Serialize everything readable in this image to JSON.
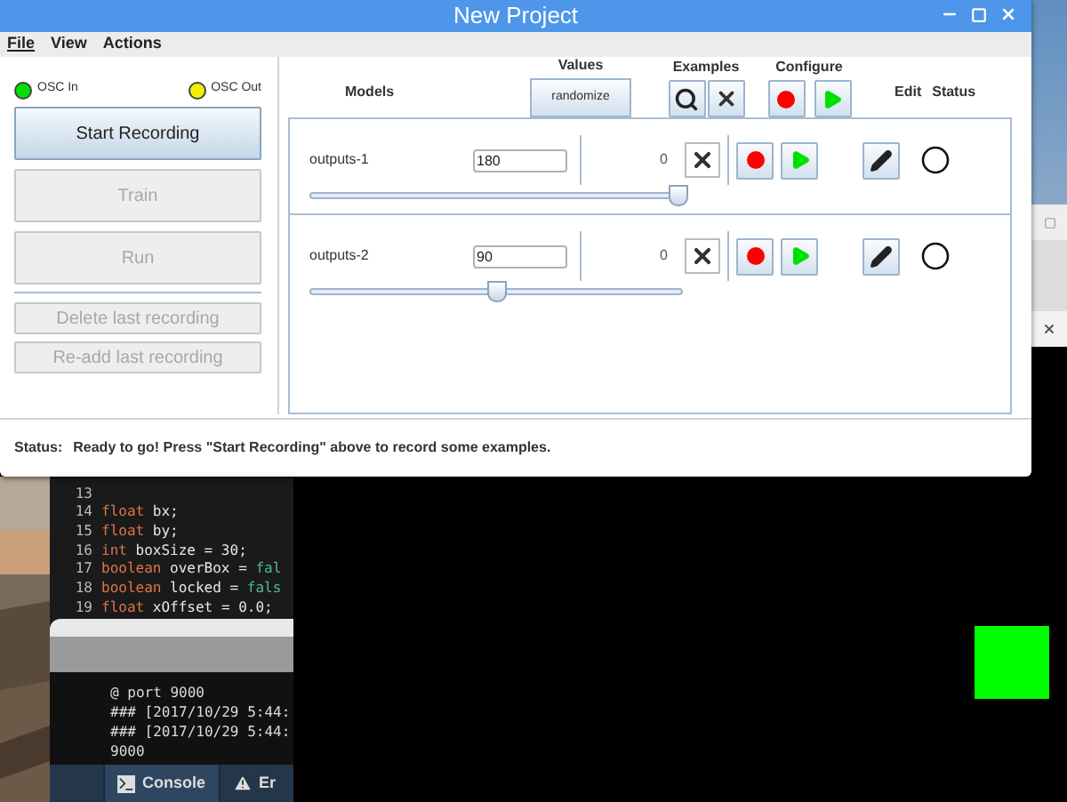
{
  "window": {
    "title": "New Project"
  },
  "menu": [
    {
      "label": "File",
      "underlined": true
    },
    {
      "label": "View",
      "underlined": false
    },
    {
      "label": "Actions",
      "underlined": false
    }
  ],
  "osc": [
    {
      "label": "OSC In",
      "color": "#00e000"
    },
    {
      "label": "OSC Out",
      "color": "#f0f000"
    }
  ],
  "main_buttons": [
    {
      "label": "Start Recording",
      "disabled": false
    },
    {
      "label": "Train",
      "disabled": true
    },
    {
      "label": "Run",
      "disabled": true
    }
  ],
  "secondary_buttons": [
    {
      "label": "Delete last recording",
      "disabled": true
    },
    {
      "label": "Re-add last recording",
      "disabled": true
    }
  ],
  "headers": {
    "models": "Models",
    "values": "Values",
    "randomize": "randomize",
    "examples": "Examples",
    "configure": "Configure",
    "edit": "Edit",
    "status": "Status"
  },
  "models": [
    {
      "name": "outputs-1",
      "value": "180",
      "count": "0",
      "level": 1.0,
      "active": false
    },
    {
      "name": "outputs-2",
      "value": "90",
      "count": "0",
      "level": 0.5,
      "active": false
    }
  ],
  "status_bar": {
    "label": "Status:",
    "message": "Ready to go! Press \"Start Recording\" above to record some examples."
  },
  "editor": {
    "lines": [
      {
        "number": "13"
      },
      {
        "number": "14",
        "tokens": [
          {
            "kind": "type",
            "text": "float"
          },
          {
            "kind": "plain",
            "text": " bx;"
          }
        ]
      },
      {
        "number": "15",
        "tokens": [
          {
            "kind": "type",
            "text": "float"
          },
          {
            "kind": "plain",
            "text": " by;"
          }
        ]
      },
      {
        "number": "16",
        "tokens": [
          {
            "kind": "type",
            "text": "int"
          },
          {
            "kind": "plain",
            "text": " boxSize = 30;"
          }
        ]
      },
      {
        "number": "17",
        "tokens": [
          {
            "kind": "type",
            "text": "boolean"
          },
          {
            "kind": "plain",
            "text": " overBox = "
          },
          {
            "kind": "literal",
            "text": "fal"
          }
        ]
      },
      {
        "number": "18",
        "tokens": [
          {
            "kind": "type",
            "text": "boolean"
          },
          {
            "kind": "plain",
            "text": " locked = "
          },
          {
            "kind": "literal",
            "text": "fals"
          }
        ]
      },
      {
        "number": "19",
        "tokens": [
          {
            "kind": "type",
            "text": "float"
          },
          {
            "kind": "plain",
            "text": " xOffset = 0.0;"
          }
        ]
      }
    ],
    "console": [
      "@ port 9000",
      "### [2017/10/29 5:44:",
      "### [2017/10/29 5:44:",
      "9000"
    ],
    "tabs": [
      {
        "label": "Console",
        "kind": "console",
        "selected": true
      },
      {
        "label": "Er",
        "kind": "errors",
        "selected": false
      }
    ]
  }
}
